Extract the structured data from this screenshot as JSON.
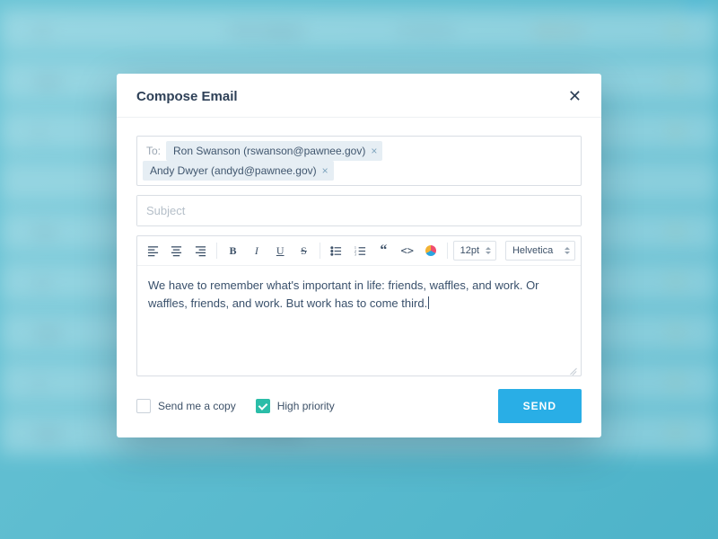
{
  "modal": {
    "title": "Compose Email",
    "to_label": "To:",
    "recipients": [
      "Ron Swanson (rswanson@pawnee.gov)",
      "Andy Dwyer (andyd@pawnee.gov)"
    ],
    "subject_placeholder": "Subject",
    "subject_value": "",
    "toolbar": {
      "font_size": "12pt",
      "font_family": "Helvetica"
    },
    "body_text": "We have to remember what's important in life: friends, waffles, and work. Or waffles, friends, and work. But work has to come third.",
    "options": {
      "send_copy_label": "Send me a copy",
      "send_copy_checked": false,
      "high_priority_label": "High priority",
      "high_priority_checked": true
    },
    "send_label": "SEND"
  },
  "background": {
    "category_label": "First Category",
    "date_a": "07 30 14",
    "date_b": "08 01 14"
  }
}
